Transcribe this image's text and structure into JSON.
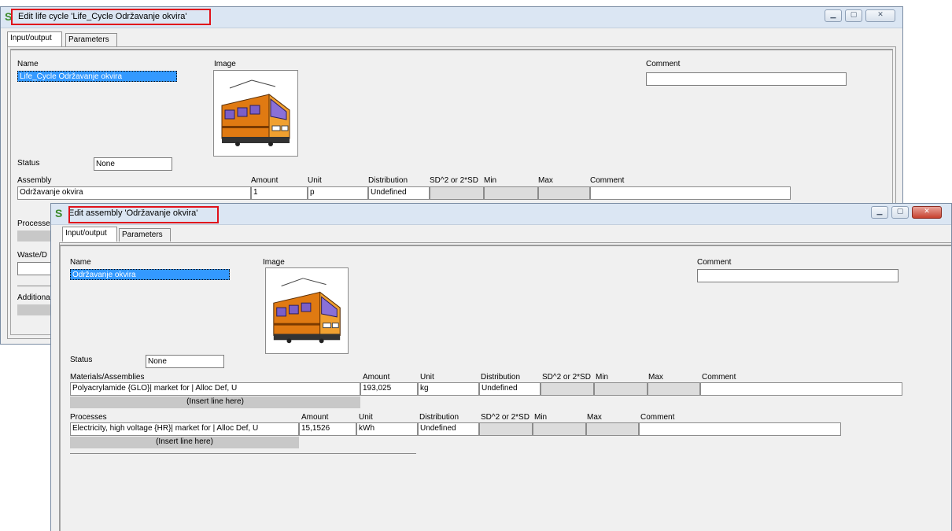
{
  "back": {
    "title": "Edit life cycle 'Life_Cycle Održavanje okvira'",
    "tabs": [
      "Input/output",
      "Parameters"
    ],
    "name_label": "Name",
    "name_value": "Life_Cycle Održavanje okvira",
    "image_label": "Image",
    "comment_label": "Comment",
    "status_label": "Status",
    "status_value": "None",
    "assembly": {
      "header": [
        "Assembly",
        "Amount",
        "Unit",
        "Distribution",
        "SD^2 or 2*SD",
        "Min",
        "Max",
        "Comment"
      ],
      "row": [
        "Održavanje okvira",
        "1",
        "p",
        "Undefined"
      ]
    },
    "processes_label": "Processe",
    "waste_label": "Waste/D",
    "additional_label": "Additiona"
  },
  "front": {
    "title": "Edit assembly 'Održavanje okvira'",
    "tabs": [
      "Input/output",
      "Parameters"
    ],
    "name_label": "Name",
    "name_value": "Održavanje okvira",
    "image_label": "Image",
    "comment_label": "Comment",
    "status_label": "Status",
    "status_value": "None",
    "materials": {
      "header": [
        "Materials/Assemblies",
        "Amount",
        "Unit",
        "Distribution",
        "SD^2 or 2*SD",
        "Min",
        "Max",
        "Comment"
      ],
      "row": [
        "Polyacrylamide {GLO}| market for | Alloc Def, U",
        "193,025",
        "kg",
        "Undefined"
      ],
      "insert": "(Insert line here)"
    },
    "processes": {
      "header": [
        "Processes",
        "Amount",
        "Unit",
        "Distribution",
        "SD^2 or 2*SD",
        "Min",
        "Max",
        "Comment"
      ],
      "row": [
        "Electricity, high voltage {HR}| market for | Alloc Def, U",
        "15,1526",
        "kWh",
        "Undefined"
      ],
      "insert": "(Insert line here)"
    }
  },
  "icons": {
    "app": "simapro-logo-icon",
    "image": "train-icon"
  },
  "colors": {
    "highlight": "#e0121b",
    "selection": "#3399ff",
    "close_button": "#c6412f"
  }
}
